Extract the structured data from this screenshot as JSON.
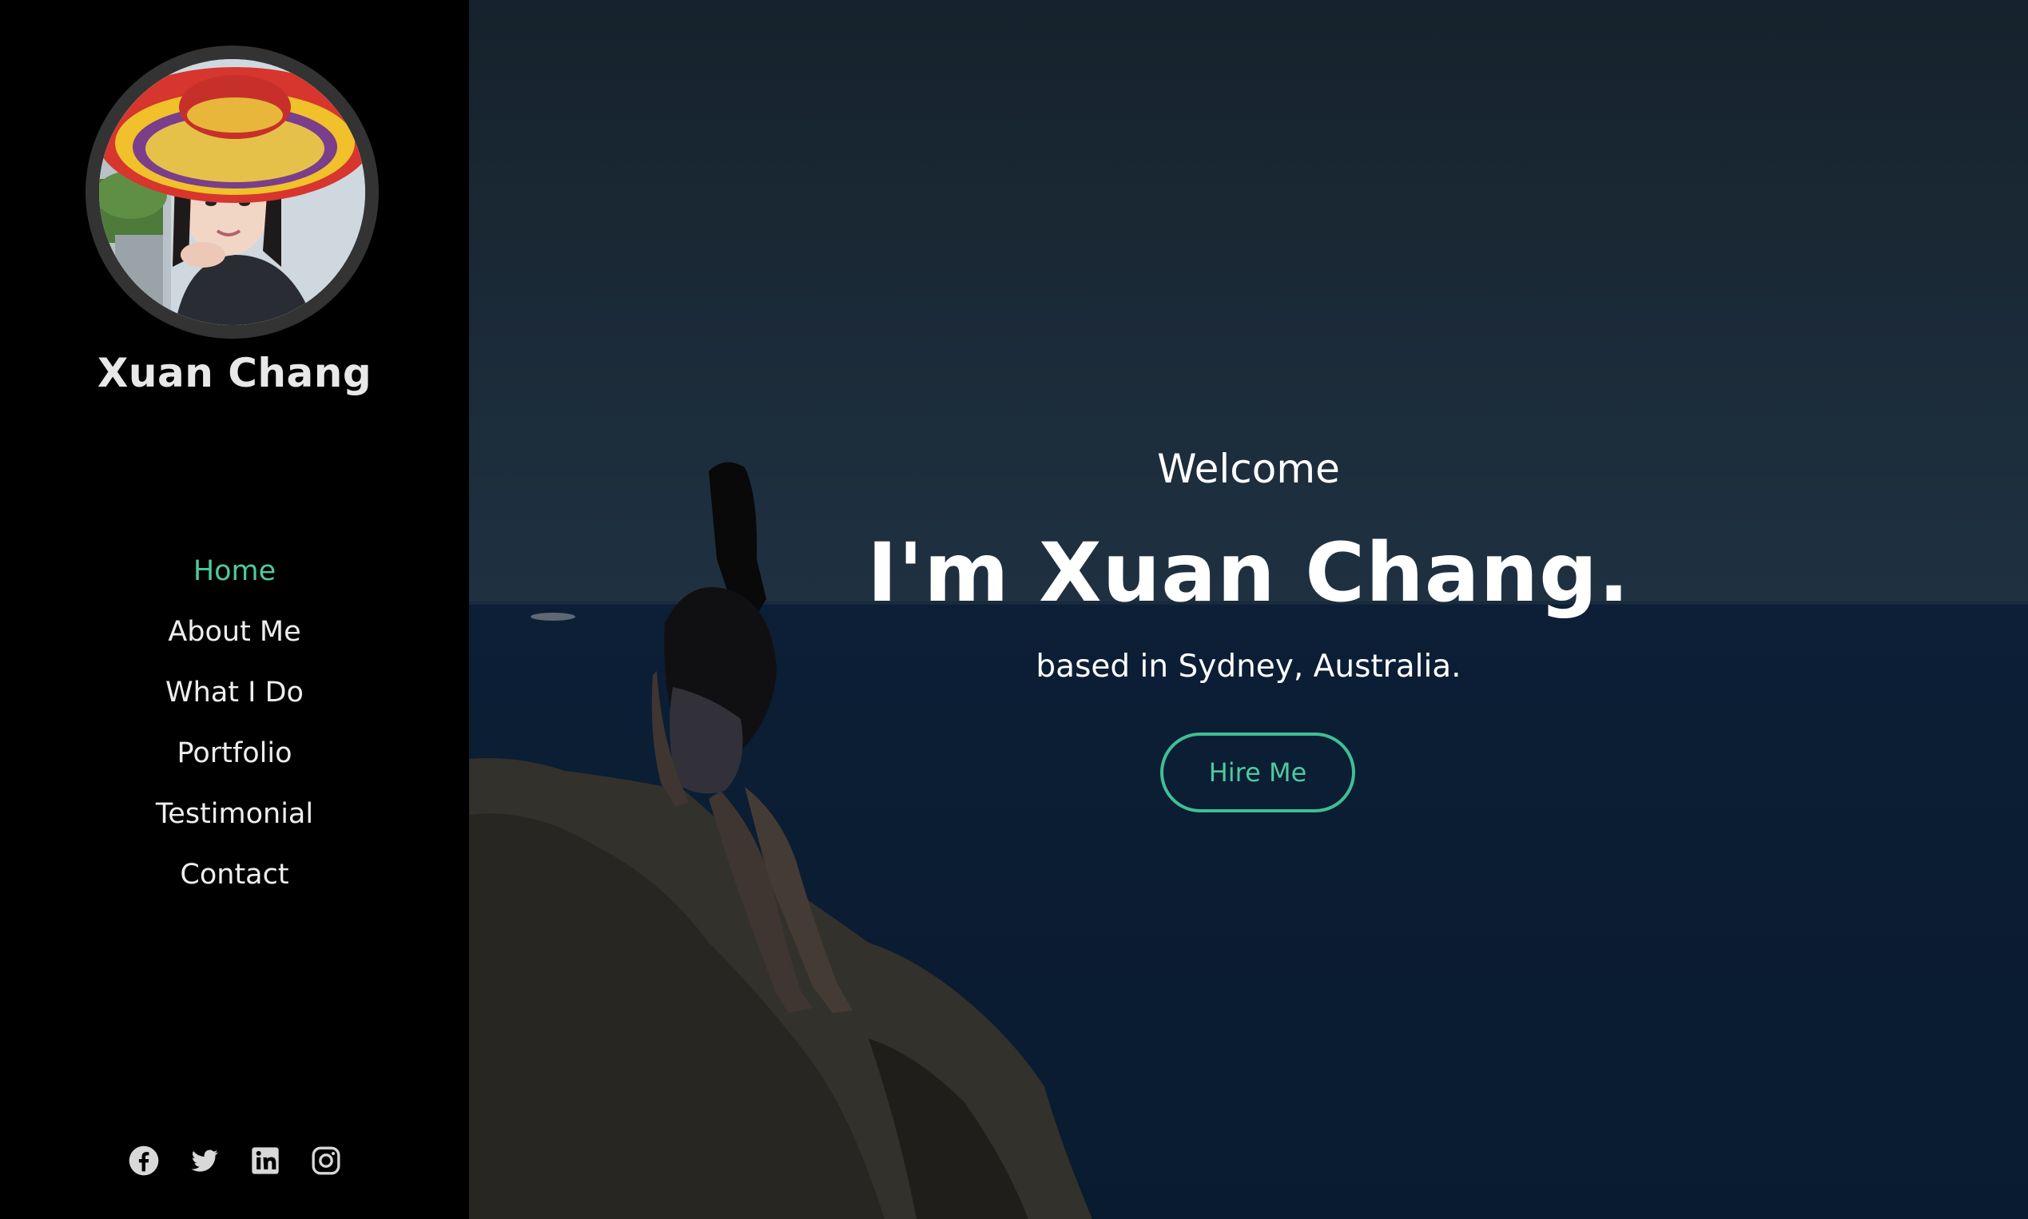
{
  "sidebar": {
    "name": "Xuan Chang",
    "nav": [
      {
        "label": "Home",
        "active": true
      },
      {
        "label": "About Me",
        "active": false
      },
      {
        "label": "What I Do",
        "active": false
      },
      {
        "label": "Portfolio",
        "active": false
      },
      {
        "label": "Testimonial",
        "active": false
      },
      {
        "label": "Contact",
        "active": false
      }
    ],
    "social_icons": [
      "facebook-icon",
      "twitter-icon",
      "linkedin-icon",
      "instagram-icon"
    ]
  },
  "hero": {
    "welcome": "Welcome",
    "headline": "I'm Xuan Chang.",
    "subline": "based in Sydney, Australia.",
    "cta_label": "Hire Me"
  },
  "colors": {
    "accent": "#4fc8a0",
    "sidebar_bg": "#000000",
    "text": "#ffffff"
  }
}
